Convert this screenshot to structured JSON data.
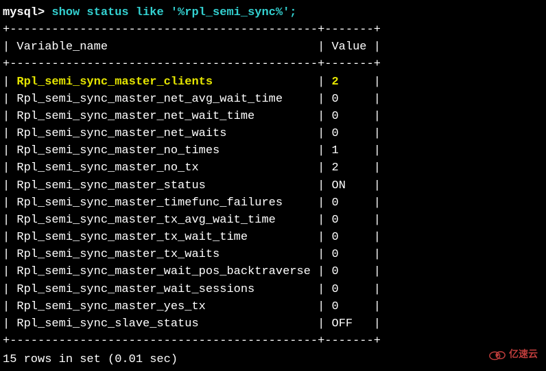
{
  "prompt": "mysql>",
  "command": " show status like '%rpl_semi_sync%';",
  "separator_top": "+--------------------------------------------+-------+",
  "header": {
    "variable_name": "Variable_name",
    "value": "Value"
  },
  "separator_header": "+--------------------------------------------+-------+",
  "rows": [
    {
      "name": "Rpl_semi_sync_master_clients",
      "value": "2",
      "highlight": true
    },
    {
      "name": "Rpl_semi_sync_master_net_avg_wait_time",
      "value": "0",
      "highlight": false
    },
    {
      "name": "Rpl_semi_sync_master_net_wait_time",
      "value": "0",
      "highlight": false
    },
    {
      "name": "Rpl_semi_sync_master_net_waits",
      "value": "0",
      "highlight": false
    },
    {
      "name": "Rpl_semi_sync_master_no_times",
      "value": "1",
      "highlight": false
    },
    {
      "name": "Rpl_semi_sync_master_no_tx",
      "value": "2",
      "highlight": false
    },
    {
      "name": "Rpl_semi_sync_master_status",
      "value": "ON",
      "highlight": false
    },
    {
      "name": "Rpl_semi_sync_master_timefunc_failures",
      "value": "0",
      "highlight": false
    },
    {
      "name": "Rpl_semi_sync_master_tx_avg_wait_time",
      "value": "0",
      "highlight": false
    },
    {
      "name": "Rpl_semi_sync_master_tx_wait_time",
      "value": "0",
      "highlight": false
    },
    {
      "name": "Rpl_semi_sync_master_tx_waits",
      "value": "0",
      "highlight": false
    },
    {
      "name": "Rpl_semi_sync_master_wait_pos_backtraverse",
      "value": "0",
      "highlight": false
    },
    {
      "name": "Rpl_semi_sync_master_wait_sessions",
      "value": "0",
      "highlight": false
    },
    {
      "name": "Rpl_semi_sync_master_yes_tx",
      "value": "0",
      "highlight": false
    },
    {
      "name": "Rpl_semi_sync_slave_status",
      "value": "OFF",
      "highlight": false
    }
  ],
  "separator_bottom": "+--------------------------------------------+-------+",
  "footer": "15 rows in set (0.01 sec)",
  "watermark": "亿速云",
  "col_widths": {
    "name": 42,
    "value": 5
  }
}
